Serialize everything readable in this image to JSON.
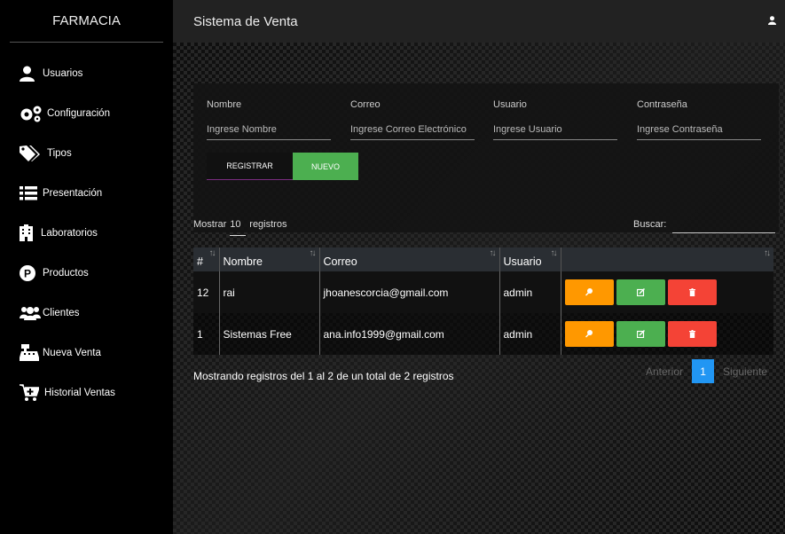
{
  "sidebar": {
    "brand": "FARMACIA",
    "items": [
      {
        "label": "Usuarios",
        "icon": "user-icon"
      },
      {
        "label": "Configuración",
        "icon": "gears-icon"
      },
      {
        "label": "Tipos",
        "icon": "tags-icon"
      },
      {
        "label": "Presentación",
        "icon": "list-icon"
      },
      {
        "label": "Laboratorios",
        "icon": "building-icon"
      },
      {
        "label": "Productos",
        "icon": "product-icon"
      },
      {
        "label": "Clientes",
        "icon": "users-icon"
      },
      {
        "label": "Nueva Venta",
        "icon": "cash-register-icon"
      },
      {
        "label": "Historial Ventas",
        "icon": "cart-plus-icon"
      }
    ]
  },
  "header": {
    "title": "Sistema de Venta",
    "user_icon": "user-icon"
  },
  "form": {
    "fields": [
      {
        "label": "Nombre",
        "placeholder": "Ingrese Nombre"
      },
      {
        "label": "Correo",
        "placeholder": "Ingrese Correo Electrónico"
      },
      {
        "label": "Usuario",
        "placeholder": "Ingrese Usuario"
      },
      {
        "label": "Contraseña",
        "placeholder": "Ingrese Contraseña"
      }
    ],
    "register_label": "REGISTRAR",
    "new_label": "NUEVO"
  },
  "table_controls": {
    "show_prefix": "Mostrar",
    "show_value": "10",
    "show_suffix": "registros",
    "search_label": "Buscar:"
  },
  "table": {
    "columns": [
      "#",
      "Nombre",
      "Correo",
      "Usuario",
      ""
    ],
    "rows": [
      {
        "id": "12",
        "nombre": "rai",
        "correo": "jhoanescorcia@gmail.com",
        "usuario": "admin"
      },
      {
        "id": "1",
        "nombre": "Sistemas Free",
        "correo": "ana.info1999@gmail.com",
        "usuario": "admin"
      }
    ]
  },
  "info": "Mostrando registros del 1 al 2 de un total de 2 registros",
  "pagination": {
    "prev": "Anterior",
    "current": "1",
    "next": "Siguiente"
  },
  "colors": {
    "accent_blue": "#2196f3",
    "green": "#4caf50",
    "orange": "#ff9800",
    "red": "#f44336"
  }
}
